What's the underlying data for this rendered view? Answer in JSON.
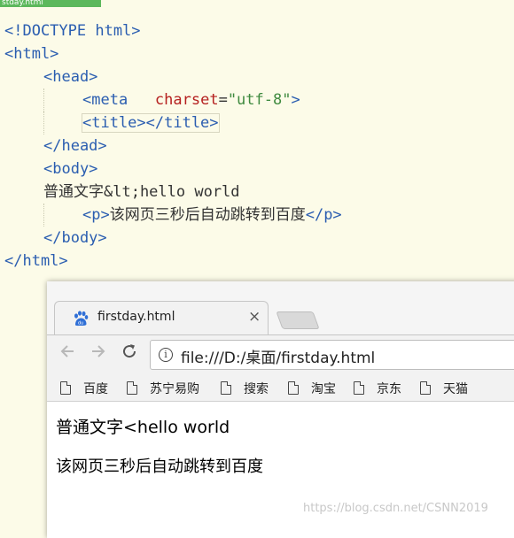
{
  "editor": {
    "tab_label": "stday.html",
    "lines": [
      {
        "indent": 0,
        "parts": [
          {
            "t": "tag",
            "v": "<!DOCTYPE html>"
          }
        ]
      },
      {
        "indent": 0,
        "parts": [
          {
            "t": "tag",
            "v": "<html>"
          }
        ]
      },
      {
        "indent": 1,
        "parts": [
          {
            "t": "tag",
            "v": "<head>"
          }
        ]
      },
      {
        "indent": 2,
        "parts": [
          {
            "t": "tag",
            "v": "<meta"
          },
          {
            "t": "txt",
            "v": "   "
          },
          {
            "t": "attr",
            "v": "charset"
          },
          {
            "t": "txt",
            "v": "="
          },
          {
            "t": "str",
            "v": "\"utf-8\""
          },
          {
            "t": "tag",
            "v": ">"
          }
        ]
      },
      {
        "indent": 2,
        "parts": [
          {
            "t": "tag",
            "v": "<title></title>"
          }
        ],
        "highlight": true
      },
      {
        "indent": 1,
        "parts": [
          {
            "t": "tag",
            "v": "</head>"
          }
        ]
      },
      {
        "indent": 1,
        "parts": [
          {
            "t": "tag",
            "v": "<body>"
          }
        ]
      },
      {
        "indent": 1,
        "parts": [
          {
            "t": "txt",
            "v": "普通文字&lt;hello world"
          }
        ]
      },
      {
        "indent": 2,
        "parts": [
          {
            "t": "tag",
            "v": "<p>"
          },
          {
            "t": "txt",
            "v": "该网页三秒后自动跳转到百度"
          },
          {
            "t": "tag",
            "v": "</p>"
          }
        ]
      },
      {
        "indent": 1,
        "parts": [
          {
            "t": "tag",
            "v": "</body>"
          }
        ]
      },
      {
        "indent": 0,
        "parts": [
          {
            "t": "tag",
            "v": "</html>"
          }
        ]
      }
    ]
  },
  "browser": {
    "tab_title": "firstday.html",
    "close_glyph": "×",
    "url": "file:///D:/桌面/firstday.html",
    "bookmarks": [
      "百度",
      "苏宁易购",
      "搜索",
      "淘宝",
      "京东",
      "天猫"
    ],
    "content": {
      "line1": "普通文字<hello world",
      "line2": "该网页三秒后自动跳转到百度"
    },
    "icons": {
      "favicon": "baidu-paw-icon",
      "back": "arrow-left-icon",
      "forward": "arrow-right-icon",
      "reload": "reload-icon",
      "info": "info-icon",
      "bookmark": "page-icon"
    },
    "colors": {
      "tag": "#2a5db0",
      "attr": "#b5201f",
      "string": "#3f8a3f",
      "favicon": "#2f6fd6"
    }
  },
  "watermark": "https://blog.csdn.net/CSNN2019"
}
